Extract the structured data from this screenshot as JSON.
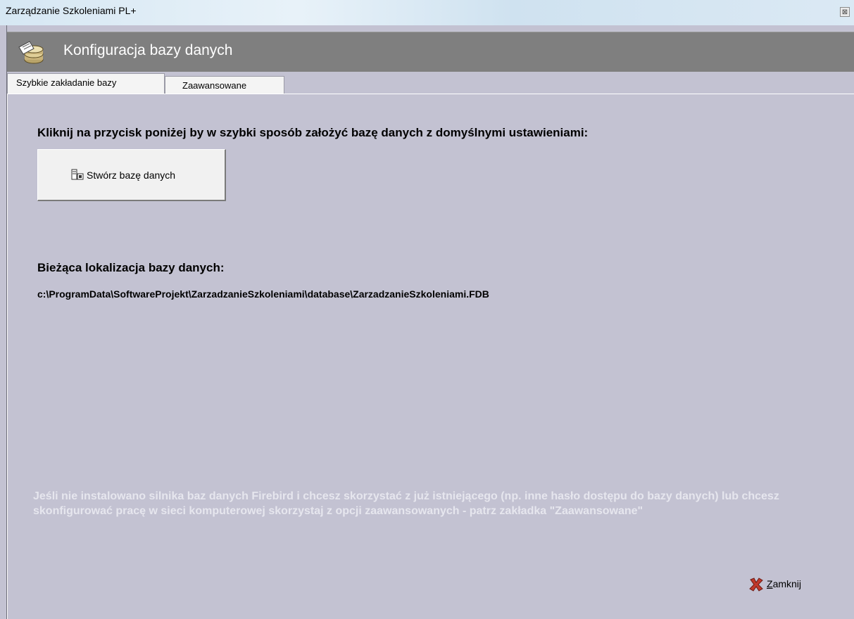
{
  "window": {
    "title": "Zarządzanie Szkoleniami PL+",
    "close_glyph": "⊠"
  },
  "header": {
    "title": "Konfiguracja bazy danych",
    "icon": "database-stack-icon"
  },
  "tabs": [
    {
      "label": "Szybkie zakładanie bazy",
      "active": true
    },
    {
      "label": "Zaawansowane",
      "active": false
    }
  ],
  "main": {
    "instruction": "Kliknij na przycisk poniżej by w szybki sposób założyć bazę danych z domyślnymi ustawieniami:",
    "create_button": {
      "label": "Stwórz bazę danych",
      "icon": "database-create-icon"
    },
    "location_label": "Bieżąca lokalizacja bazy danych:",
    "location_path": "c:\\ProgramData\\SoftwareProjekt\\ZarzadzanieSzkoleniami\\database\\ZarzadzanieSzkoleniami.FDB",
    "note": "Jeśli nie instalowano silnika baz danych Firebird i chcesz skorzystać z już istniejącego (np. inne hasło dostępu do bazy danych) lub chcesz skonfigurować pracę w sieci komputerowej skorzystaj z opcji zaawansowanych - patrz zakładka \"Zaawansowane\""
  },
  "footer": {
    "close_label_first": "Z",
    "close_label_rest": "amknij",
    "close_icon": "red-x-icon"
  },
  "colors": {
    "panel_bg": "#c3c2d2",
    "header_bg": "#7f7f7f",
    "note_text": "#e6e6ee"
  }
}
